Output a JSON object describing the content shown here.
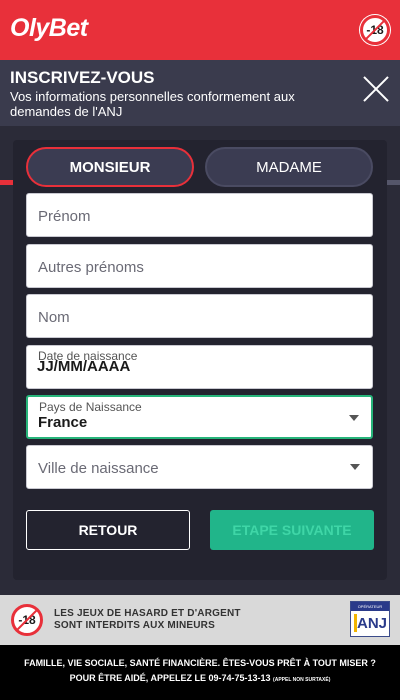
{
  "brand": {
    "name": "OlyBet",
    "age_badge": "-18"
  },
  "header": {
    "title": "INSCRIVEZ-VOUS",
    "subtitle": "Vos informations personnelles conformement aux demandes de l'ANJ",
    "progress": 0.34
  },
  "gender": {
    "option1": "MONSIEUR",
    "option2": "MADAME",
    "selected": "MONSIEUR"
  },
  "form": {
    "first_name_placeholder": "Prénom",
    "other_names_placeholder": "Autres prénoms",
    "last_name_placeholder": "Nom",
    "dob_label": "Date de naissance",
    "dob_value": "JJ/MM/AAAA",
    "country_label": "Pays de Naissance",
    "country_value": "France",
    "city_placeholder": "Ville de naissance"
  },
  "buttons": {
    "back": "RETOUR",
    "next": "ETAPE SUIVANTE"
  },
  "footer": {
    "age_badge": "-18",
    "warning_line1": "LES JEUX DE HASARD ET D'ARGENT",
    "warning_line2": "SONT INTERDITS AUX MINEURS",
    "anj_top": "OPÉRATEUR AGRÉÉ",
    "anj_name": "ANJ",
    "line1": "FAMILLE, VIE SOCIALE, SANTÉ FINANCIÈRE. ÊTES-VOUS PRÊT À TOUT MISER ?",
    "line2": "POUR ÊTRE AIDÉ, APPELEZ LE 09-74-75-13-13",
    "line2_note": "(APPEL NON SURTAXÉ)"
  },
  "colors": {
    "brand_red": "#e8303a",
    "accent_green": "#21b58a",
    "background": "#2b2b38"
  }
}
